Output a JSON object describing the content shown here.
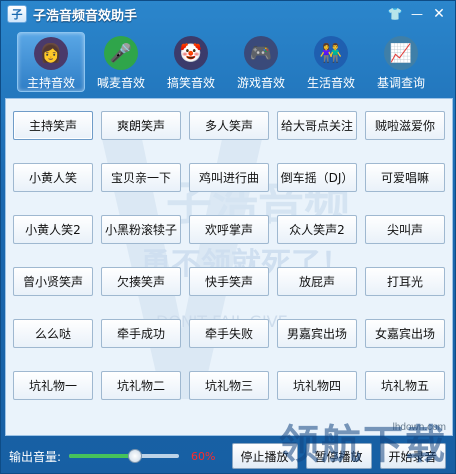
{
  "window": {
    "title": "子浩音频音效助手",
    "logo_text": "子",
    "controls": {
      "skin": "👕",
      "minimize": "—",
      "close": "✕"
    }
  },
  "tabs": [
    {
      "label": "主持音效",
      "icon": "host-avatar-icon",
      "glyph": "👩",
      "color": "#4a3a6a",
      "active": true
    },
    {
      "label": "喊麦音效",
      "icon": "microphone-icon",
      "glyph": "🎤",
      "color": "#2fa54a",
      "active": false
    },
    {
      "label": "搞笑音效",
      "icon": "funny-face-icon",
      "glyph": "🤡",
      "color": "#3b3b6b",
      "active": false
    },
    {
      "label": "游戏音效",
      "icon": "game-console-icon",
      "glyph": "🎮",
      "color": "#3a4a7a",
      "active": false
    },
    {
      "label": "生活音效",
      "icon": "people-icon",
      "glyph": "👫",
      "color": "#1f5fb0",
      "active": false
    },
    {
      "label": "基调查询",
      "icon": "monitor-chart-icon",
      "glyph": "📈",
      "color": "#3f7fa8",
      "active": false
    }
  ],
  "sounds": [
    "主持笑声",
    "爽朗笑声",
    "多人笑声",
    "给大哥点关注",
    "贼啦滋爱你",
    "小黄人笑",
    "宝贝亲一下",
    "鸡叫进行曲",
    "倒车摇（DJ）",
    "可爱唱嘛",
    "小黄人笑2",
    "小黑粉滚犊子",
    "欢呼掌声",
    "众人笑声2",
    "尖叫声",
    "曾小贤笑声",
    "欠揍笑声",
    "快手笑声",
    "放屁声",
    "打耳光",
    "么么哒",
    "牵手成功",
    "牵手失败",
    "男嘉宾出场",
    "女嘉宾出场",
    "坑礼物一",
    "坑礼物二",
    "坑礼物三",
    "坑礼物四",
    "坑礼物五"
  ],
  "watermark": {
    "line1": "子浩音频",
    "line2": "勇不领就死了！",
    "line3": "DON'T FAIL GIVE"
  },
  "site_mark": "lhdown.com",
  "bottom": {
    "volume_label": "输出音量:",
    "volume_percent": "60%",
    "volume_value": 0.6,
    "stop_label": "停止播放",
    "pause_label": "暂停播放",
    "record_label": "开始录音"
  },
  "overlay_brand": "领航下载"
}
